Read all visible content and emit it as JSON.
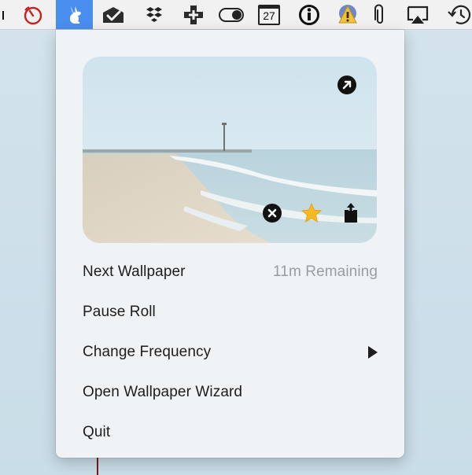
{
  "menubar": {
    "calendar_day": "27"
  },
  "menu": {
    "items": [
      {
        "label": "Next Wallpaper",
        "detail": "11m Remaining"
      },
      {
        "label": "Pause Roll",
        "detail": ""
      },
      {
        "label": "Change Frequency",
        "detail": ""
      },
      {
        "label": "Open Wallpaper Wizard",
        "detail": ""
      },
      {
        "label": "Quit",
        "detail": ""
      }
    ]
  },
  "colors": {
    "accent": "#4a8ef0",
    "favorite_star": "#f5b921",
    "secondary_text": "#9a9da0"
  }
}
